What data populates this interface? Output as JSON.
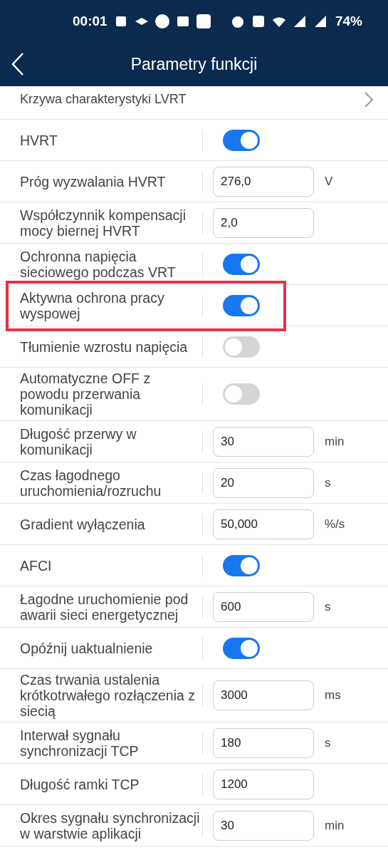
{
  "status_bar": {
    "time": "00:01",
    "battery": "74%"
  },
  "header": {
    "title": "Parametry funkcji"
  },
  "rows": [
    {
      "kind": "link",
      "label": "Krzywa charakterystyki LVRT"
    },
    {
      "kind": "switch",
      "label": "HVRT",
      "on": true
    },
    {
      "kind": "input",
      "label": "Próg wyzwalania HVRT",
      "value": "276,0",
      "unit": "V"
    },
    {
      "kind": "input",
      "label": "Współczynnik kompensacji mocy biernej HVRT",
      "value": "2,0"
    },
    {
      "kind": "switch",
      "label": "Ochronna napięcia sieciowego podczas VRT",
      "on": true
    },
    {
      "kind": "switch",
      "label": "Aktywna ochrona pracy wyspowej",
      "on": true,
      "highlighted": true
    },
    {
      "kind": "switch",
      "label": "Tłumienie wzrostu napięcia",
      "on": false
    },
    {
      "kind": "switch",
      "label": "Automatyczne OFF z powodu przerwania komunikacji",
      "on": false
    },
    {
      "kind": "input",
      "label": "Długość przerwy w komunikacji",
      "value": "30",
      "unit": "min"
    },
    {
      "kind": "input",
      "label": "Czas łagodnego uruchomienia/rozruchu",
      "value": "20",
      "unit": "s"
    },
    {
      "kind": "input",
      "label": "Gradient wyłączenia",
      "value": "50,000",
      "unit": "%/s"
    },
    {
      "kind": "switch",
      "label": "AFCI",
      "on": true
    },
    {
      "kind": "input",
      "label": "Łagodne uruchomienie pod awarii sieci energetycznej",
      "value": "600",
      "unit": "s"
    },
    {
      "kind": "switch",
      "label": "Opóźnij uaktualnienie",
      "on": true
    },
    {
      "kind": "input",
      "label": "Czas trwania ustalenia krótkotrwałego rozłączenia z siecią",
      "value": "3000",
      "unit": "ms"
    },
    {
      "kind": "input",
      "label": "Interwał sygnału synchronizacji TCP",
      "value": "180",
      "unit": "s"
    },
    {
      "kind": "input",
      "label": "Długość ramki TCP",
      "value": "1200"
    },
    {
      "kind": "input",
      "label": "Okres sygnału synchronizacji w warstwie aplikacji",
      "value": "30",
      "unit": "min"
    }
  ]
}
